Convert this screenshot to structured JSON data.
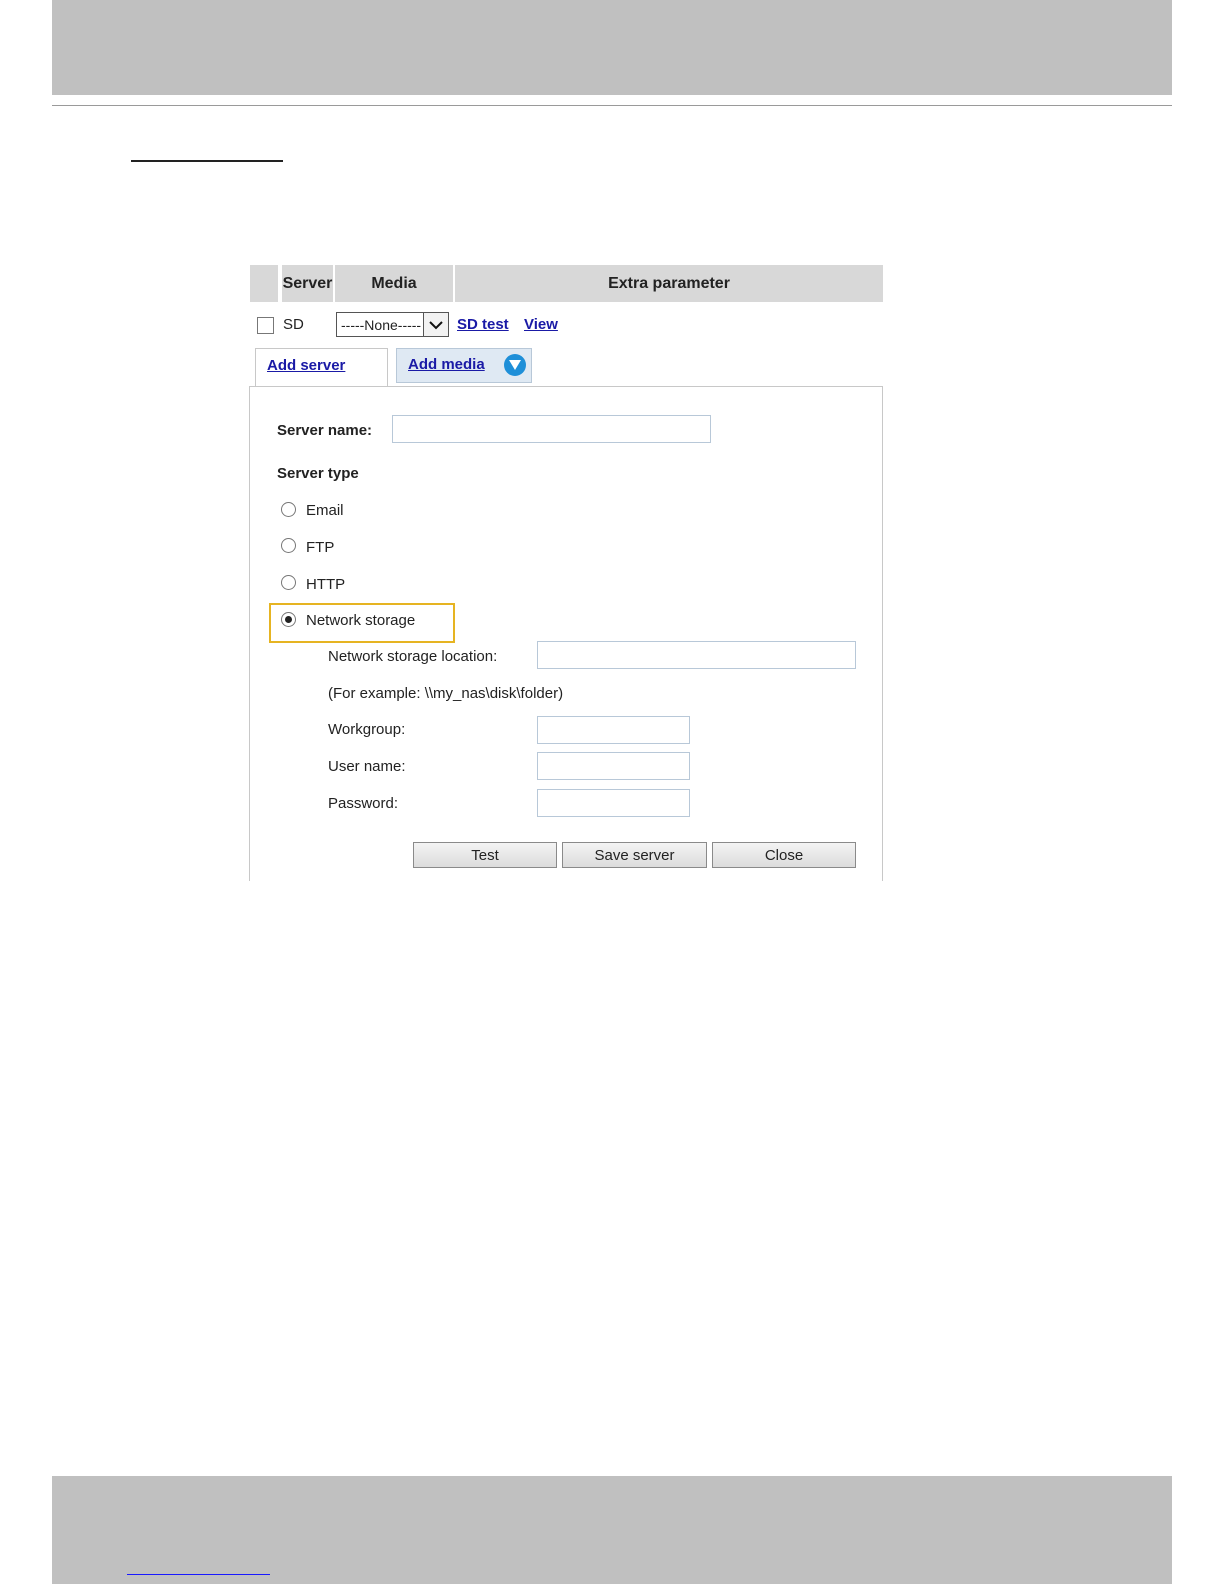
{
  "table_header": {
    "server": "Server",
    "media": "Media",
    "extra_parameter": "Extra parameter"
  },
  "sd_row": {
    "label": "SD",
    "checked": false,
    "media_select_value": "-----None-----",
    "sd_test_link": "SD test",
    "view_link": "View"
  },
  "tabs": {
    "add_server": "Add server",
    "add_media": "Add media"
  },
  "form": {
    "server_name_label": "Server name:",
    "server_name_value": "",
    "server_type_label": "Server type",
    "server_types": [
      {
        "label": "Email",
        "selected": false
      },
      {
        "label": "FTP",
        "selected": false
      },
      {
        "label": "HTTP",
        "selected": false
      },
      {
        "label": "Network storage",
        "selected": true
      }
    ],
    "network_storage": {
      "location_label": "Network storage location:",
      "location_value": "",
      "example_text": "(For example: \\\\my_nas\\disk\\folder)",
      "workgroup_label": "Workgroup:",
      "workgroup_value": "",
      "username_label": "User name:",
      "username_value": "",
      "password_label": "Password:",
      "password_value": ""
    },
    "buttons": {
      "test": "Test",
      "save_server": "Save server",
      "close": "Close"
    }
  },
  "colors": {
    "link": "#1a1aa6",
    "highlight": "#e6b422",
    "header_bg": "#d8d8d8",
    "page_band": "#c0c0c0"
  }
}
